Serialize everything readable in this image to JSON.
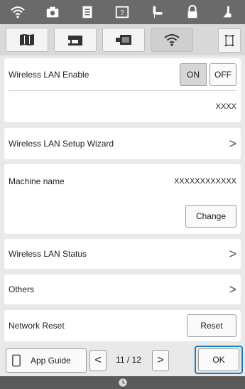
{
  "topbar": {
    "icons": [
      "wifi-icon",
      "camera-icon",
      "document-icon",
      "help-icon",
      "needle-icon",
      "lock-icon",
      "presser-foot-icon"
    ]
  },
  "tabs": {
    "items": [
      "machine-settings-icon",
      "sewing-machine-icon",
      "embroidery-icon",
      "wifi-icon"
    ],
    "active": "wifi-icon",
    "right_icon": "screen-capture-icon"
  },
  "wireless_lan": {
    "label": "Wireless LAN Enable",
    "on_label": "ON",
    "off_label": "OFF",
    "network_value": "XXXX"
  },
  "setup_wizard": {
    "label": "Wireless LAN Setup Wizard",
    "chevron": ">"
  },
  "machine_name": {
    "label": "Machine name",
    "value": "XXXXXXXXXXXX",
    "change_label": "Change"
  },
  "status": {
    "label": "Wireless LAN Status",
    "chevron": ">"
  },
  "others": {
    "label": "Others",
    "chevron": ">"
  },
  "network_reset": {
    "label": "Network Reset",
    "reset_label": "Reset"
  },
  "bottom": {
    "app_guide_label": "App Guide",
    "prev": "<",
    "next": ">",
    "page_indicator": "11 / 12",
    "ok_label": "OK"
  },
  "colors": {
    "highlight": "#1a7fc8",
    "topbar": "#6a6a6a"
  }
}
